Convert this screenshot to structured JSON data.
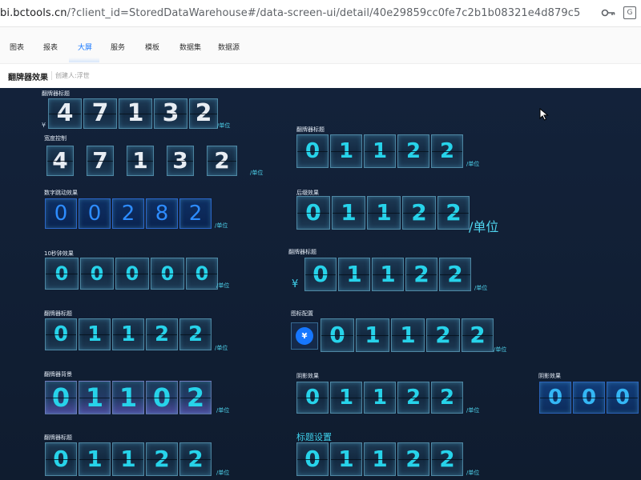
{
  "browser": {
    "url_host": "bi.bctools.cn",
    "url_path": "/?client_id=StoredDataWarehouse#/data-screen-ui/detail/40e29859cc0fe7c2b1b08321e4d879c5",
    "translate_label": "G"
  },
  "nav": {
    "tabs": [
      {
        "label": "图表"
      },
      {
        "label": "报表"
      },
      {
        "label": "大屏"
      },
      {
        "label": "服务"
      },
      {
        "label": "模板"
      },
      {
        "label": "数据集"
      },
      {
        "label": "数据源"
      }
    ],
    "active_tab": "大屏"
  },
  "page": {
    "title": "翻牌器效果",
    "creator": "创建人:浮世"
  },
  "widgets": {
    "w1": {
      "label": "翻牌器标题",
      "prefix": "¥",
      "digits": [
        "4",
        "7",
        "1",
        "3",
        "2"
      ],
      "unit": "/单位"
    },
    "w2": {
      "label": "宽度控制",
      "digits": [
        "4",
        "7",
        "1",
        "3",
        "2"
      ],
      "unit": "/单位"
    },
    "w3": {
      "label": "翻牌器标题",
      "digits": [
        "0",
        "1",
        "1",
        "2",
        "2"
      ],
      "unit": "/单位"
    },
    "w4": {
      "label": "数字跳动效果",
      "digits": [
        "0",
        "0",
        "2",
        "8",
        "2"
      ],
      "unit": "/单位"
    },
    "w5": {
      "label": "后缀效果",
      "digits": [
        "0",
        "1",
        "1",
        "2",
        "2"
      ],
      "unit": "/单位"
    },
    "w6": {
      "label": "10秒钟效果",
      "digits": [
        "0",
        "0",
        "0",
        "0",
        "0"
      ],
      "unit": "/单位"
    },
    "w7": {
      "label": "翻牌器标题",
      "prefix": "¥",
      "digits": [
        "0",
        "1",
        "1",
        "2",
        "2"
      ],
      "unit": "/单位"
    },
    "w8": {
      "label": "翻牌器标题",
      "digits": [
        "0",
        "1",
        "1",
        "2",
        "2"
      ],
      "unit": "/单位"
    },
    "w9": {
      "label": "图标配置",
      "icon_symbol": "¥",
      "digits": [
        "0",
        "1",
        "1",
        "2",
        "2"
      ],
      "unit": "/单位"
    },
    "w10": {
      "label": "翻牌器背景",
      "digits": [
        "0",
        "1",
        "1",
        "0",
        "2"
      ],
      "unit": "/单位"
    },
    "w11": {
      "label": "阴影效果",
      "digits": [
        "0",
        "1",
        "1",
        "2",
        "2"
      ],
      "unit": "/单位"
    },
    "w12": {
      "label": "阴影效果",
      "digits": [
        "0",
        "0",
        "0"
      ]
    },
    "w13": {
      "label": "翻牌器标题",
      "digits": [
        "0",
        "1",
        "1",
        "2",
        "2"
      ],
      "unit": "/单位"
    },
    "w14": {
      "label": "标题设置",
      "digits": [
        "0",
        "1",
        "1",
        "2",
        "2"
      ],
      "unit": "/单位"
    }
  },
  "colors": {
    "canvas_bg": "#0f1c2f",
    "accent_cyan": "#27d3ea",
    "accent_blue": "#1677ff"
  }
}
